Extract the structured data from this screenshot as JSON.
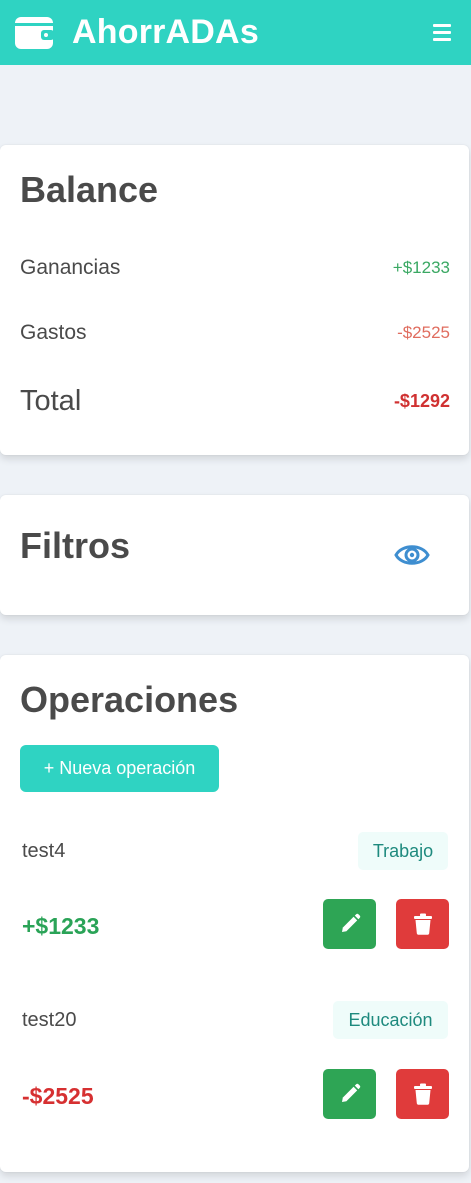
{
  "navbar": {
    "title": "AhorrADAs",
    "brand_icon": "wallet-icon",
    "menu_icon": "hamburger-menu-icon"
  },
  "balance": {
    "title": "Balance",
    "rows": [
      {
        "label": "Ganancias",
        "value": "+$1233"
      },
      {
        "label": "Gastos",
        "value": "-$2525"
      },
      {
        "label": "Total",
        "value": "-$1292"
      }
    ]
  },
  "filters": {
    "title": "Filtros",
    "toggle_icon": "eye-icon"
  },
  "operations": {
    "title": "Operaciones",
    "new_button_label": "+ Nueva operación",
    "items": [
      {
        "description": "test4",
        "category": "Trabajo",
        "amount": "+$1233",
        "type": "gain"
      },
      {
        "description": "test20",
        "category": "Educación",
        "amount": "-$2525",
        "type": "expense"
      }
    ],
    "edit_icon": "pencil-icon",
    "delete_icon": "trash-icon"
  },
  "colors": {
    "primary": "#2fd3c2",
    "gain": "#2aa357",
    "expense": "#d63031",
    "edit_button": "#2ea555",
    "delete_button": "#e03b3b",
    "eye_icon": "#3e8ed0"
  }
}
